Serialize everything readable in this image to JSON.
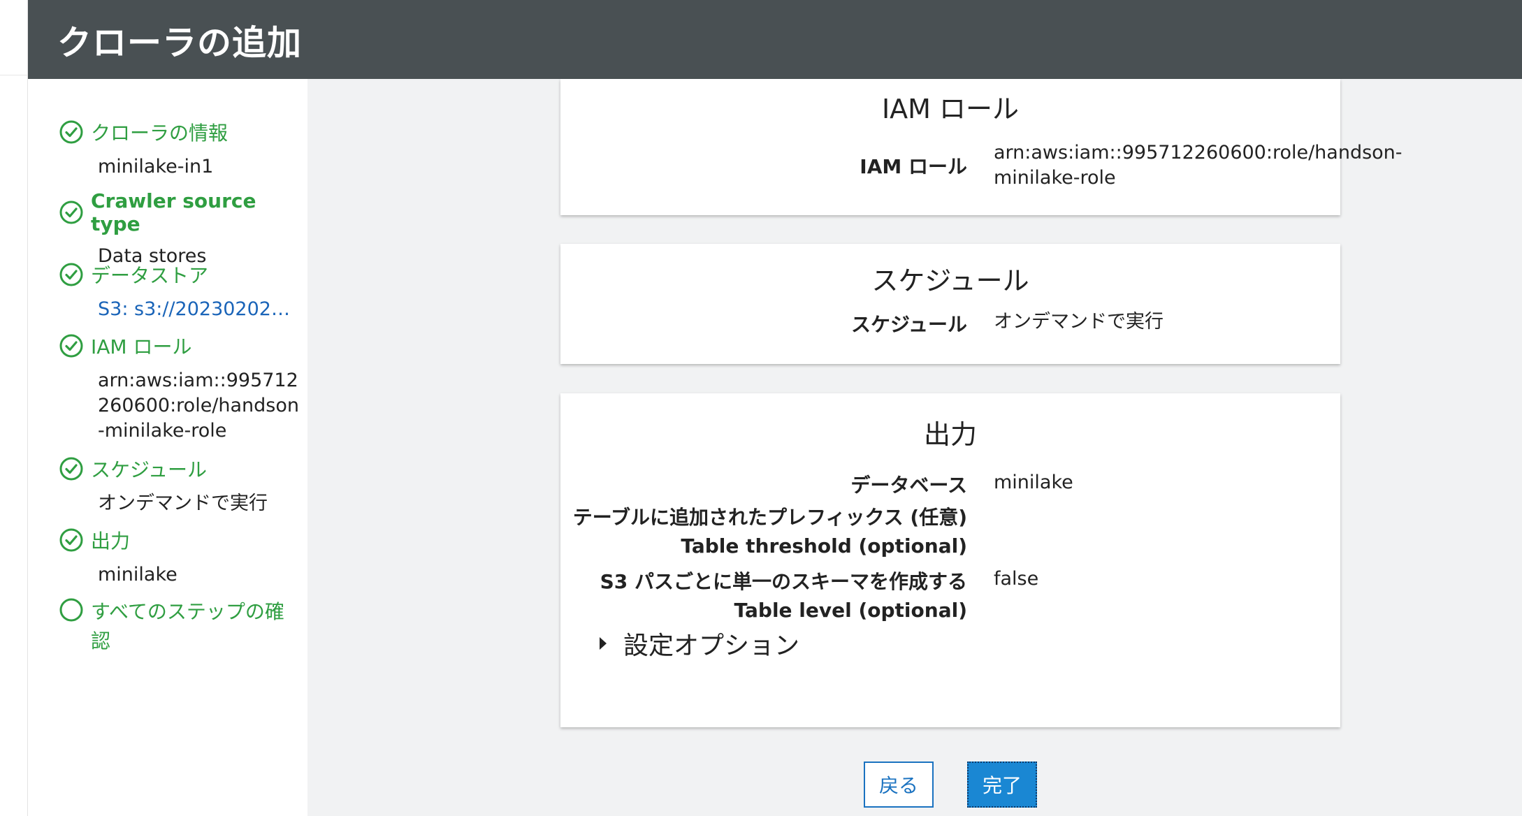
{
  "header": {
    "title": "クローラの追加"
  },
  "sidebar": {
    "steps": [
      {
        "title": "クローラの情報",
        "value": "minilake-in1",
        "status": "done"
      },
      {
        "title": "Crawler source type",
        "value": "Data stores",
        "status": "done"
      },
      {
        "title": "データストア",
        "value": "S3: s3://20230202-...",
        "status": "done"
      },
      {
        "title": "IAM ロール",
        "value": "arn:aws:iam::995712260600:role/handson-minilake-role",
        "status": "done"
      },
      {
        "title": "スケジュール",
        "value": "オンデマンドで実行",
        "status": "done"
      },
      {
        "title": "出力",
        "value": "minilake",
        "status": "done"
      },
      {
        "title": "すべてのステップの確認",
        "value": "",
        "status": "current"
      }
    ]
  },
  "iam_card": {
    "title": "IAM ロール",
    "label": "IAM ロール",
    "value_line1": "arn:aws:iam::995712260600:role/handson-",
    "value_line2": "minilake-role"
  },
  "schedule_card": {
    "title": "スケジュール",
    "label": "スケジュール",
    "value": "オンデマンドで実行"
  },
  "output_card": {
    "title": "出力",
    "rows": [
      {
        "label": "データベース",
        "value": "minilake"
      },
      {
        "label": "テーブルに追加されたプレフィックス (任意)",
        "value": ""
      },
      {
        "label": "Table threshold (optional)",
        "value": ""
      },
      {
        "label": "S3 パスごとに単一のスキーマを作成する",
        "value": "false"
      },
      {
        "label": "Table level (optional)",
        "value": ""
      }
    ],
    "options_label": "設定オプション"
  },
  "buttons": {
    "back": "戻る",
    "finish": "完了"
  },
  "colors": {
    "header_bg": "#495053",
    "step_green": "#2f9e41",
    "link_blue": "#1a64b8",
    "primary": "#1a87d3"
  }
}
